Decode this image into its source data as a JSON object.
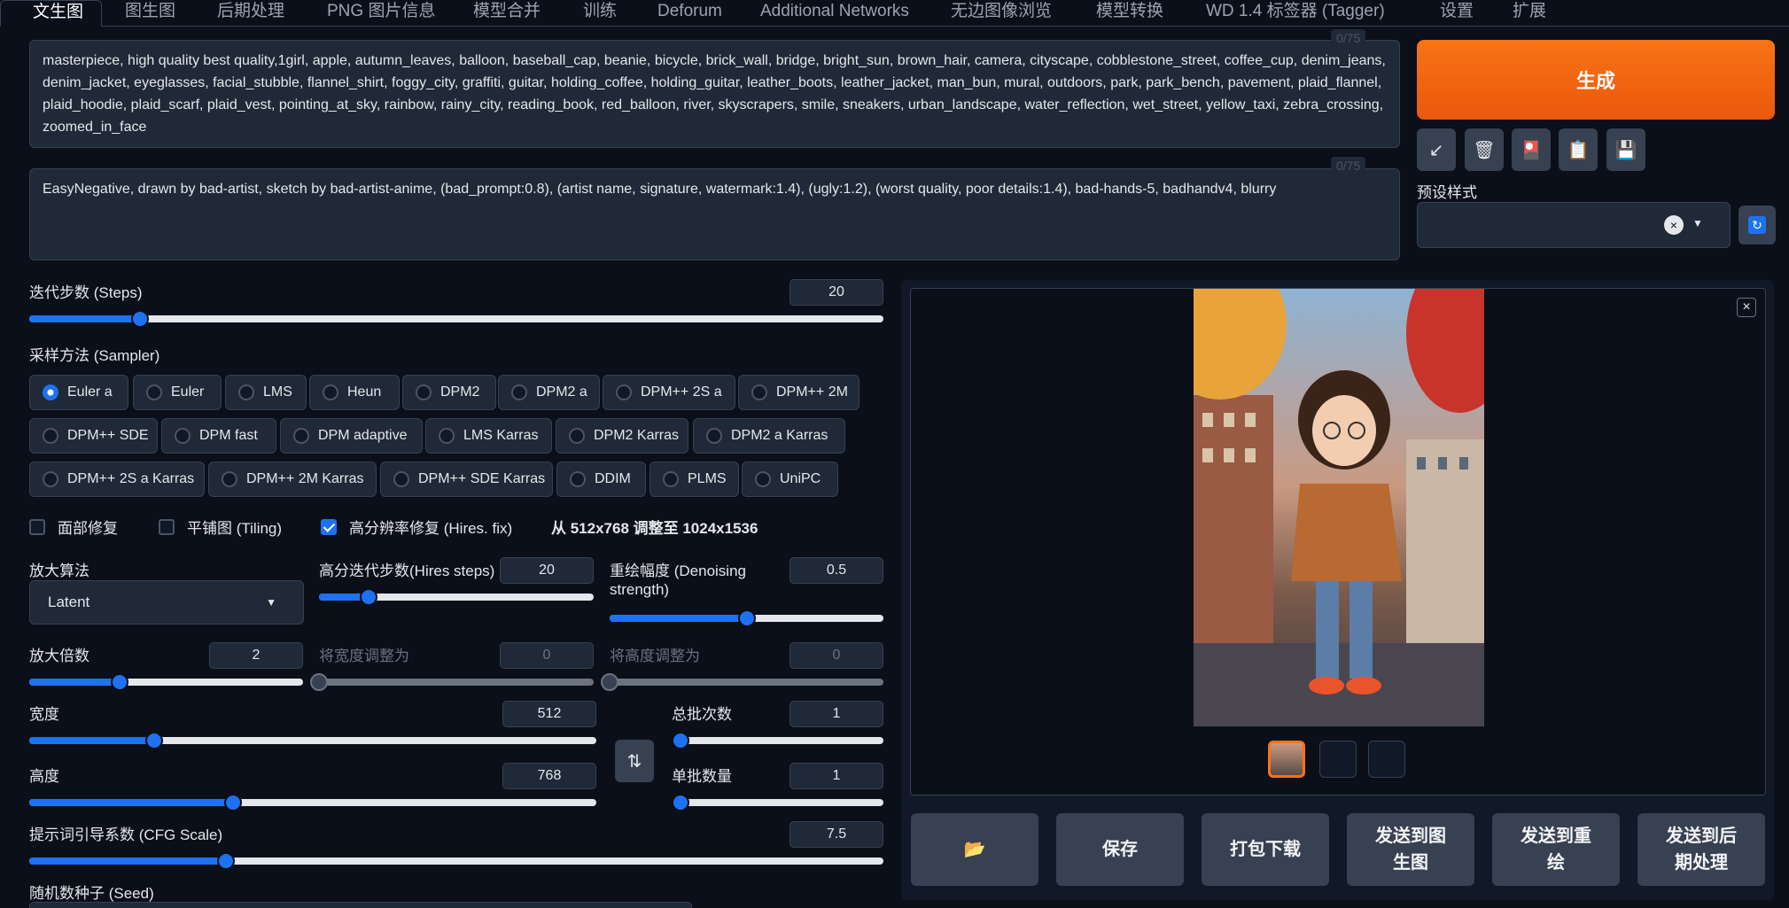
{
  "tabs": [
    "文生图",
    "图生图",
    "后期处理",
    "PNG 图片信息",
    "模型合并",
    "训练",
    "Deforum",
    "Additional Networks",
    "无边图像浏览",
    "模型转换",
    "WD 1.4 标签器 (Tagger)",
    "设置",
    "扩展"
  ],
  "prompt": {
    "positive": "masterpiece, high quality best quality,1girl, apple, autumn_leaves, balloon, baseball_cap, beanie, bicycle, brick_wall, bridge, bright_sun, brown_hair, camera, cityscape, cobblestone_street, coffee_cup, denim_jeans, denim_jacket, eyeglasses, facial_stubble, flannel_shirt, foggy_city, graffiti, guitar, holding_coffee, holding_guitar, leather_boots, leather_jacket, man_bun, mural, outdoors, park, park_bench, pavement, plaid_flannel, plaid_hoodie, plaid_scarf, plaid_vest, pointing_at_sky, rainbow, rainy_city, reading_book, red_balloon, river, skyscrapers, smile, sneakers, urban_landscape, water_reflection, wet_street, yellow_taxi, zebra_crossing, zoomed_in_face",
    "positive_counter": "0/75",
    "negative": "EasyNegative, drawn by bad-artist, sketch by bad-artist-anime, (bad_prompt:0.8), (artist name, signature, watermark:1.4), (ugly:1.2), (worst quality, poor details:1.4), bad-hands-5, badhandv4, blurry",
    "negative_counter": "0/75"
  },
  "generate_label": "生成",
  "preset_label": "预设样式",
  "steps": {
    "label": "迭代步数 (Steps)",
    "value": "20",
    "fraction": 0.13
  },
  "sampler": {
    "label": "采样方法 (Sampler)",
    "selected": "Euler a",
    "options": [
      "Euler a",
      "Euler",
      "LMS",
      "Heun",
      "DPM2",
      "DPM2 a",
      "DPM++ 2S a",
      "DPM++ 2M",
      "DPM++ SDE",
      "DPM fast",
      "DPM adaptive",
      "LMS Karras",
      "DPM2 Karras",
      "DPM2 a Karras",
      "DPM++ 2S a Karras",
      "DPM++ 2M Karras",
      "DPM++ SDE Karras",
      "DDIM",
      "PLMS",
      "UniPC"
    ]
  },
  "checks": {
    "face_restore": {
      "label": "面部修复",
      "checked": false
    },
    "tiling": {
      "label": "平铺图 (Tiling)",
      "checked": false
    },
    "hires_fix": {
      "label": "高分辨率修复 (Hires. fix)",
      "checked": true
    }
  },
  "hires_info": "从 512x768 调整至 1024x1536",
  "upscaler": {
    "label": "放大算法",
    "value": "Latent"
  },
  "hires_steps": {
    "label": "高分迭代步数(Hires steps)",
    "value": "20",
    "fraction": 0.18
  },
  "denoising": {
    "label": "重绘幅度 (Denoising strength)",
    "label_line1": "重绘幅度 (Denoising",
    "label_line2": "strength)",
    "value": "0.5",
    "fraction": 0.5
  },
  "upscale_by": {
    "label": "放大倍数",
    "value": "2",
    "fraction": 0.33
  },
  "resize_width": {
    "label": "将宽度调整为",
    "value": "0",
    "fraction": 0
  },
  "resize_height": {
    "label": "将高度调整为",
    "value": "0",
    "fraction": 0
  },
  "width": {
    "label": "宽度",
    "value": "512",
    "fraction": 0.22
  },
  "height": {
    "label": "高度",
    "value": "768",
    "fraction": 0.36
  },
  "batch_count": {
    "label": "总批次数",
    "value": "1",
    "fraction": 0
  },
  "batch_size": {
    "label": "单批数量",
    "value": "1",
    "fraction": 0
  },
  "cfg": {
    "label": "提示词引导系数 (CFG Scale)",
    "value": "7.5",
    "fraction": 0.23
  },
  "seed": {
    "label": "随机数种子 (Seed)"
  },
  "actions": {
    "save": "保存",
    "zip": "打包下载",
    "to_img2img": "发送到图生图",
    "to_img2img_l1": "发送到图",
    "to_img2img_l2": "生图",
    "to_inpaint_l1": "发送到重",
    "to_inpaint_l2": "绘",
    "to_extras_l1": "发送到后",
    "to_extras_l2": "期处理"
  },
  "colors": {
    "accent": "#1d72f2",
    "generate": "#f97316",
    "bg": "#0b0f19",
    "panel": "#1f2937"
  }
}
